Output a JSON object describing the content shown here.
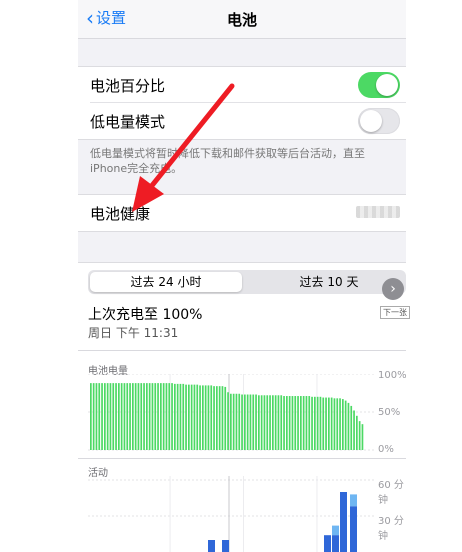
{
  "nav": {
    "back_label": "设置",
    "title": "电池"
  },
  "settings": {
    "battery_percentage": {
      "label": "电池百分比",
      "on": true
    },
    "low_power_mode": {
      "label": "低电量模式",
      "on": false
    },
    "footnote": "低电量模式将暂时降低下载和邮件获取等后台活动，直至iPhone完全充电。",
    "battery_health": {
      "label": "电池健康"
    }
  },
  "segments": {
    "options": [
      "过去 24 小时",
      "过去 10 天"
    ],
    "selected": 0
  },
  "last_charge": {
    "title": "上次充电至 100%",
    "time": "周日 下午 11:31"
  },
  "battery_level": {
    "section_label": "电池电量",
    "y_ticks": [
      "100%",
      "50%",
      "0%"
    ]
  },
  "activity": {
    "section_label": "活动",
    "y_ticks": [
      "60 分钟",
      "30 分钟"
    ]
  },
  "colors": {
    "accent": "#1a7cf5",
    "toggle_on": "#4cd964",
    "battery_bar": "#4cd964",
    "activity_dark": "#2f67d8",
    "activity_light": "#6fb6f2"
  },
  "chart_data": [
    {
      "type": "bar",
      "title": "电池电量",
      "ylim": [
        0,
        100
      ],
      "y_ticks": [
        "100%",
        "50%",
        "0%"
      ],
      "values": [
        88,
        88,
        88,
        88,
        88,
        88,
        88,
        88,
        88,
        88,
        88,
        88,
        88,
        88,
        88,
        88,
        88,
        88,
        88,
        88,
        88,
        88,
        88,
        88,
        88,
        88,
        88,
        88,
        88,
        88,
        87,
        87,
        87,
        87,
        86,
        86,
        86,
        86,
        86,
        85,
        85,
        85,
        85,
        85,
        84,
        84,
        84,
        84,
        83,
        76,
        74,
        74,
        74,
        74,
        73,
        73,
        73,
        73,
        73,
        73,
        72,
        72,
        72,
        72,
        72,
        72,
        72,
        72,
        72,
        71,
        71,
        71,
        71,
        71,
        71,
        71,
        71,
        71,
        71,
        70,
        70,
        70,
        70,
        69,
        69,
        69,
        69,
        68,
        68,
        68,
        67,
        65,
        62,
        58,
        52,
        45,
        38,
        34
      ]
    },
    {
      "type": "bar",
      "title": "活动",
      "ylim": [
        0,
        60
      ],
      "y_ticks": [
        "60 分钟",
        "30 分钟"
      ],
      "series": [
        {
          "name": "",
          "values": [
            0,
            0,
            0,
            0,
            0,
            0,
            0,
            0,
            0,
            0,
            0,
            0,
            0,
            0,
            0,
            0,
            0,
            0,
            0,
            0,
            18,
            18,
            0,
            0,
            0,
            0,
            0,
            0,
            0,
            0,
            0,
            0,
            0,
            0,
            0,
            0,
            0,
            0,
            0,
            0,
            0,
            0,
            0,
            0,
            0,
            0,
            0,
            0,
            0,
            0,
            0,
            0,
            0,
            0,
            0,
            0,
            0,
            0,
            0,
            0,
            0,
            0,
            0,
            0,
            0,
            0,
            0,
            0,
            0,
            0,
            0,
            0,
            0,
            0,
            0,
            0,
            0,
            0,
            0,
            0,
            0,
            0,
            0,
            0,
            0,
            0,
            0,
            0,
            0,
            0,
            0,
            0,
            0,
            0,
            0,
            0,
            0,
            0,
            0,
            0,
            0,
            0,
            0,
            0,
            0,
            0,
            0,
            0,
            0,
            0,
            0,
            0,
            0,
            0,
            0,
            0,
            0,
            0,
            0,
            0,
            0,
            0,
            0,
            0,
            0,
            0,
            0,
            0,
            0,
            0,
            0,
            0,
            0,
            0,
            0,
            0,
            0,
            0,
            0,
            0,
            0,
            0,
            0,
            0,
            0,
            0,
            0,
            0,
            0,
            0,
            0,
            0,
            0,
            0,
            0,
            0,
            0,
            0,
            0,
            0,
            0,
            0,
            0,
            0,
            0,
            0,
            0,
            0,
            0,
            0,
            0,
            0,
            0,
            0,
            0,
            0,
            0,
            0,
            0,
            0,
            0,
            0,
            0,
            0,
            0,
            0,
            0,
            0,
            0,
            0,
            0,
            0,
            0,
            0,
            0,
            0,
            0,
            0,
            0,
            0,
            0
          ]
        }
      ],
      "bars": [
        {
          "slot": 0,
          "dark": 10,
          "light": 0
        },
        {
          "slot": 1,
          "dark": 10,
          "light": 0
        },
        {
          "slot": 2,
          "dark": 14,
          "light": 0
        },
        {
          "slot": 3,
          "dark": 14,
          "light": 8
        },
        {
          "slot": 4,
          "dark": 50,
          "light": 0
        },
        {
          "slot": 5,
          "dark": 38,
          "light": 10
        }
      ]
    }
  ]
}
